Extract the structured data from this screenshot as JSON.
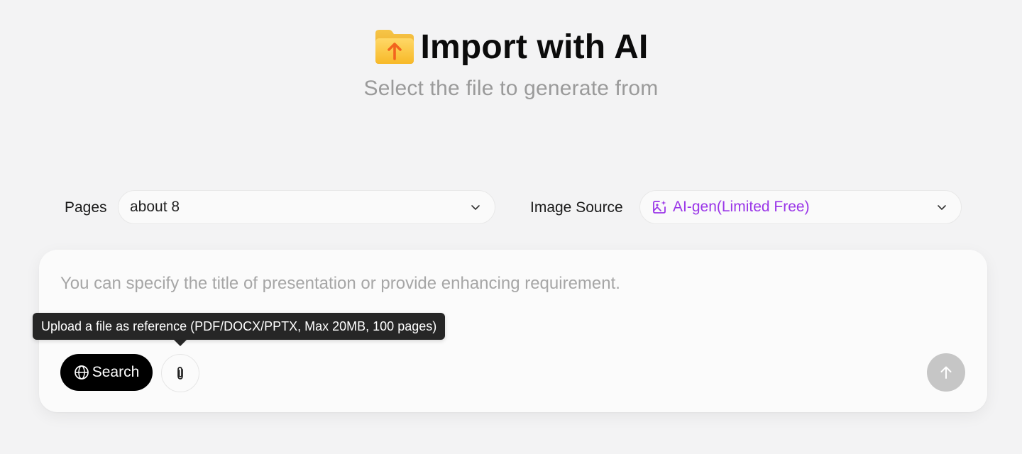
{
  "header": {
    "title": "Import with AI",
    "subtitle": "Select the file to generate from",
    "icon": "folder-upload-icon"
  },
  "options": {
    "pages": {
      "label": "Pages",
      "value": "about 8"
    },
    "image_source": {
      "label": "Image Source",
      "value": "AI-gen(Limited Free)",
      "accent": "#9a35e8"
    }
  },
  "prompt": {
    "placeholder": "You can specify the title of presentation or provide enhancing requirement."
  },
  "actions": {
    "search_label": "Search",
    "attach_tooltip": "Upload a file as reference (PDF/DOCX/PPTX, Max 20MB, 100 pages)"
  },
  "colors": {
    "background": "#f3f3f4",
    "card": "#fbfbfb",
    "search_button": "#000000",
    "send_button_disabled": "#c6c6c6",
    "tooltip": "#262626"
  }
}
